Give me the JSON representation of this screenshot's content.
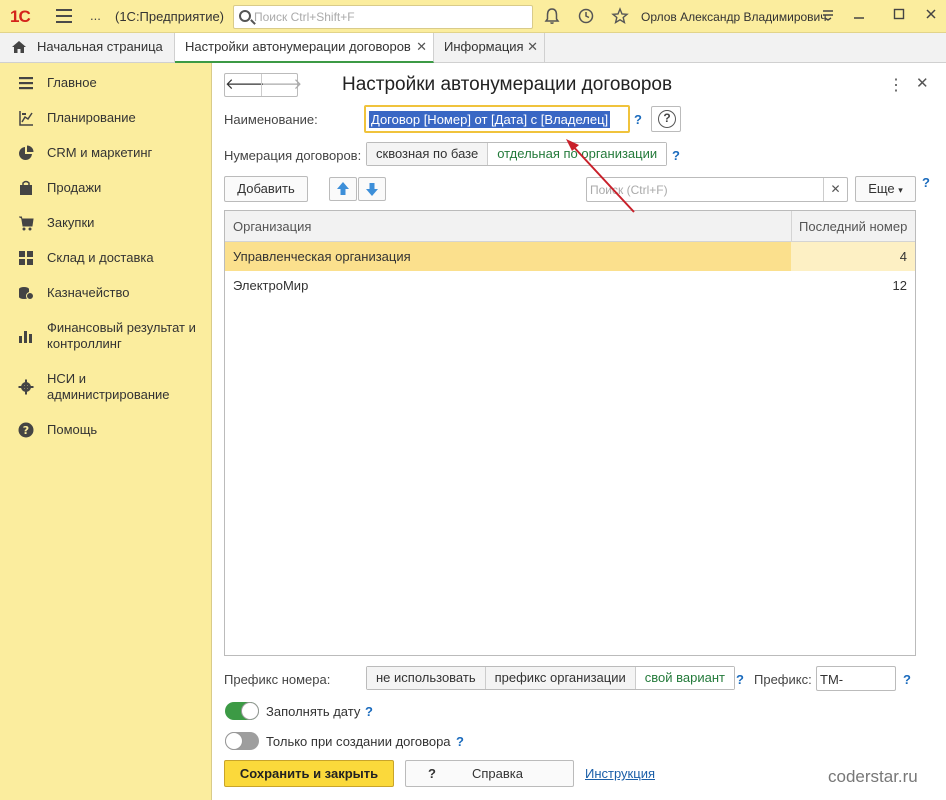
{
  "topbar": {
    "logo": "1С",
    "dots": "...",
    "app_title": "(1С:Предприятие)",
    "search_placeholder": "Поиск Ctrl+Shift+F",
    "user": "Орлов Александр Владимирович"
  },
  "tabs": [
    {
      "label": "Начальная страница"
    },
    {
      "label": "Настройки автонумерации договоров"
    },
    {
      "label": "Информация"
    }
  ],
  "sidebar": {
    "items": [
      {
        "label": "Главное",
        "icon": "menu-icon"
      },
      {
        "label": "Планирование",
        "icon": "planning-icon"
      },
      {
        "label": "CRM и маркетинг",
        "icon": "pie-chart-icon"
      },
      {
        "label": "Продажи",
        "icon": "shopping-bag-icon"
      },
      {
        "label": "Закупки",
        "icon": "cart-icon"
      },
      {
        "label": "Склад и доставка",
        "icon": "grid-icon"
      },
      {
        "label": "Казначейство",
        "icon": "coins-icon"
      },
      {
        "label": "Финансовый результат и контроллинг",
        "icon": "bar-chart-icon"
      },
      {
        "label": "НСИ и администрирование",
        "icon": "gear-icon"
      },
      {
        "label": "Помощь",
        "icon": "help-icon"
      }
    ]
  },
  "form": {
    "title": "Настройки автонумерации договоров",
    "name_label": "Наименование:",
    "name_value": "Договор [Номер] от [Дата] с [Владелец]",
    "q": "?",
    "numbering_label": "Нумерация договоров:",
    "numbering_options": [
      "сквозная по базе",
      "отдельная по организации"
    ],
    "numbering_selected": 1,
    "add_button": "Добавить",
    "search_placeholder": "Поиск (Ctrl+F)",
    "more_button": "Еще",
    "table": {
      "columns": [
        "Организация",
        "Последний номер"
      ],
      "rows": [
        {
          "org": "Управленческая организация",
          "last": "4"
        },
        {
          "org": "ЭлектроМир",
          "last": "12"
        }
      ],
      "selected_row": 0
    },
    "prefix_label": "Префикс номера:",
    "prefix_options": [
      "не использовать",
      "префикс организации",
      "свой вариант"
    ],
    "prefix_selected": 2,
    "prefix_field_label": "Префикс:",
    "prefix_value": "ТМ-",
    "fill_date_label": "Заполнять дату",
    "fill_date_on": true,
    "only_create_label": "Только при создании договора",
    "only_create_on": false,
    "save_button": "Сохранить и закрыть",
    "help_button_q": "?",
    "help_button": "Справка",
    "instruction_link": "Инструкция"
  },
  "watermark": "coderstar.ru",
  "colors": {
    "accent_green": "#3c9a45",
    "topbar_yellow": "#fbed9e",
    "save_yellow": "#fbd93b",
    "annotation_arrow": "#c8202a"
  }
}
